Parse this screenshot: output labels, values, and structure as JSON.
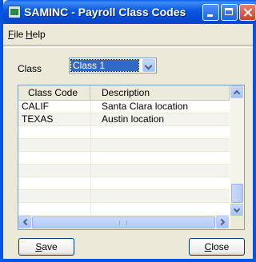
{
  "window": {
    "title": "SAMINC - Payroll Class Codes"
  },
  "menu": {
    "file_ul": "F",
    "file_rest": "ile",
    "help_ul": "H",
    "help_rest": "elp"
  },
  "class_field": {
    "label": "Class",
    "selected": "Class 1"
  },
  "grid": {
    "columns": [
      "Class Code",
      "Description"
    ],
    "rows": [
      {
        "code": "CALIF",
        "description": "Santa Clara location"
      },
      {
        "code": "TEXAS",
        "description": "Austin location"
      }
    ]
  },
  "buttons": {
    "save_ul": "S",
    "save_rest": "ave",
    "close_ul": "C",
    "close_rest": "lose"
  },
  "colors": {
    "titlebar": "#0a56e0",
    "selection": "#316ac5",
    "dialog_bg": "#ece9d8"
  }
}
